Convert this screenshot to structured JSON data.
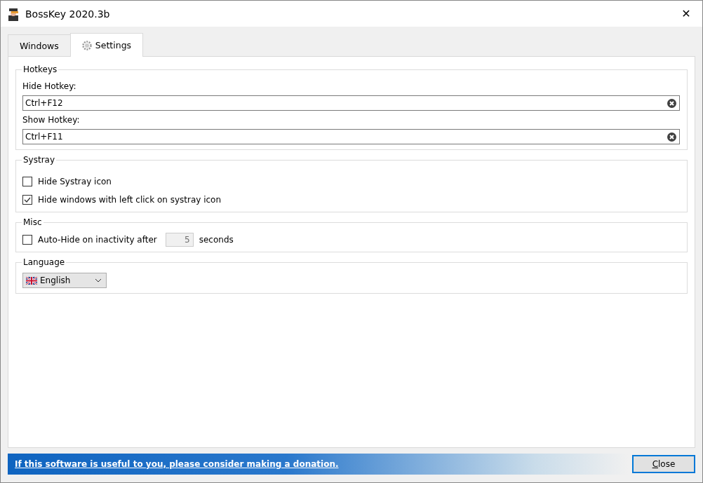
{
  "window": {
    "title": "BossKey 2020.3b",
    "close": "✕"
  },
  "tabs": [
    {
      "label": "Windows",
      "selected": false,
      "icon": false
    },
    {
      "label": "Settings",
      "selected": true,
      "icon": true
    }
  ],
  "hotkeys": {
    "title": "Hotkeys",
    "fields": [
      {
        "label": "Hide Hotkey:",
        "value": "Ctrl+F12"
      },
      {
        "label": "Show Hotkey:",
        "value": "Ctrl+F11"
      }
    ]
  },
  "systray": {
    "title": "Systray",
    "options": [
      {
        "label": "Hide Systray icon",
        "checked": false
      },
      {
        "label": "Hide windows with left click on systray icon",
        "checked": true
      }
    ]
  },
  "misc": {
    "title": "Misc",
    "label": "Auto-Hide on inactivity after",
    "checked": false,
    "value": "5",
    "value_disabled": true,
    "unit": "seconds"
  },
  "language": {
    "title": "Language",
    "value": "English"
  },
  "footer": {
    "link": "If this software is useful to you, please consider making a donation.",
    "button": "Close"
  }
}
